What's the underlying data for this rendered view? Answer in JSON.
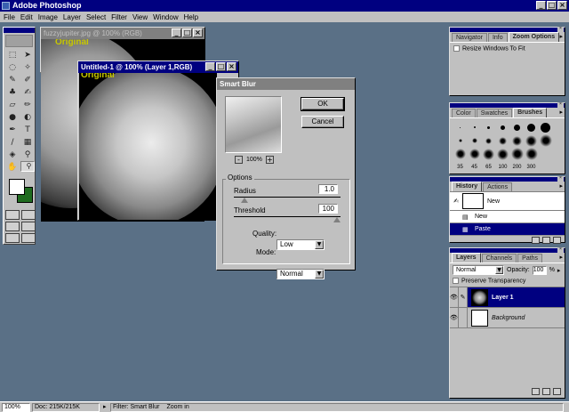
{
  "app": {
    "title": "Adobe Photoshop",
    "icon": "photoshop-icon"
  },
  "menu": [
    "File",
    "Edit",
    "Image",
    "Layer",
    "Select",
    "Filter",
    "View",
    "Window",
    "Help"
  ],
  "toolbox": {
    "tools": [
      "marquee-icon",
      "move-icon",
      "lasso-icon",
      "magic-wand-icon",
      "airbrush-icon",
      "paintbrush-icon",
      "rubber-stamp-icon",
      "history-brush-icon",
      "eraser-icon",
      "pencil-icon",
      "blur-icon",
      "dodge-icon",
      "pen-icon",
      "type-icon",
      "measure-icon",
      "gradient-icon",
      "paint-bucket-icon",
      "eyedropper-icon",
      "hand-icon",
      "zoom-icon"
    ],
    "foreground_color": "#ffffff",
    "background_color": "#1f6b1f"
  },
  "windows": {
    "doc1": {
      "title": "fuzzyjupiter.jpg @ 100% (RGB)",
      "overlay_text": "Original"
    },
    "doc2": {
      "title": "Untitled-1 @ 100% (Layer 1,RGB)",
      "overlay_text": "Original"
    }
  },
  "dialog": {
    "title": "Smart Blur",
    "ok": "OK",
    "cancel": "Cancel",
    "zoom": "100%",
    "options_label": "Options",
    "radius_label": "Radius",
    "radius_value": "1.0",
    "threshold_label": "Threshold",
    "threshold_value": "100",
    "quality_label": "Quality:",
    "quality_value": "Low",
    "mode_label": "Mode:",
    "mode_value": "Normal"
  },
  "navigator": {
    "tabs": [
      "Navigator",
      "Info",
      "Zoom Options"
    ],
    "active_tab": "Zoom Options",
    "resize_label": "Resize Windows To Fit"
  },
  "brushes": {
    "tabs": [
      "Color",
      "Swatches",
      "Brushes"
    ],
    "active_tab": "Brushes",
    "labels": [
      "35",
      "45",
      "65",
      "100",
      "200",
      "300"
    ]
  },
  "history": {
    "tabs": [
      "History",
      "Actions"
    ],
    "active_tab": "History",
    "snapshot": "New",
    "items": [
      "New",
      "Paste"
    ],
    "active_item": "Paste"
  },
  "layers": {
    "tabs": [
      "Layers",
      "Channels",
      "Paths"
    ],
    "active_tab": "Layers",
    "blend_mode": "Normal",
    "opacity_label": "Opacity:",
    "opacity_value": "100",
    "opacity_unit": "%",
    "preserve_label": "Preserve Transparency",
    "items": [
      "Layer 1",
      "Background"
    ],
    "active_item": "Layer 1"
  },
  "status": {
    "zoom": "100%",
    "doc": "Doc: 215K/215K",
    "filter": "Filter: Smart Blur",
    "hint": "Zoom in"
  }
}
